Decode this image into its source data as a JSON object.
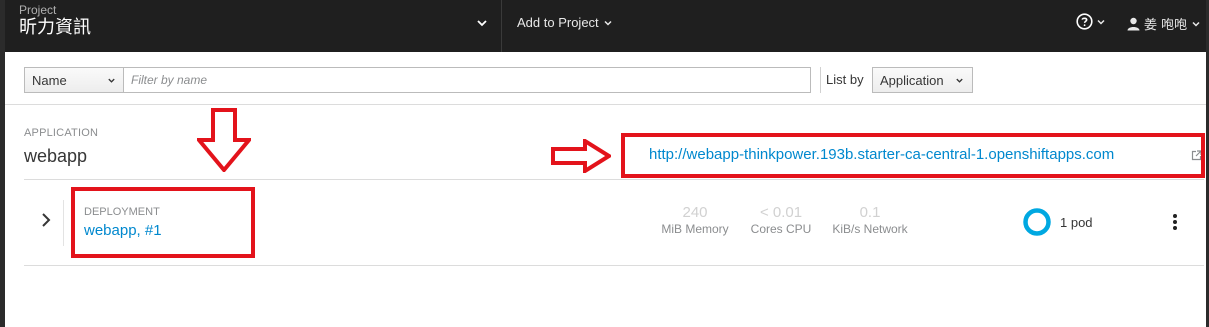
{
  "topbar": {
    "project_caption": "Project",
    "project_name": "昕力資訊",
    "add_to_project": "Add to Project",
    "user_name": "姜 咆咆"
  },
  "filter": {
    "field_select": "Name",
    "input_placeholder": "Filter by name",
    "list_by_label": "List by",
    "list_by_select": "Application"
  },
  "application": {
    "caption": "APPLICATION",
    "name": "webapp",
    "route_url": "http://webapp-thinkpower.193b.starter-ca-central-1.openshiftapps.com"
  },
  "deployment": {
    "caption": "DEPLOYMENT",
    "name": "webapp, #1",
    "metrics": [
      {
        "value": "240",
        "label": "MiB Memory"
      },
      {
        "value": "< 0.01",
        "label": "Cores CPU"
      },
      {
        "value": "0.1",
        "label": "KiB/s Network"
      }
    ],
    "pod_count": 1,
    "pod_label": "1 pod"
  },
  "colors": {
    "topbar_bg": "#1f1f1f",
    "link": "#0088ce",
    "annotation_red": "#e3131b",
    "pod_ring": "#00a8e1"
  },
  "icons": [
    "chevron-down-icon",
    "help-icon",
    "user-icon",
    "external-link-icon",
    "chevron-right-icon",
    "kebab-icon",
    "pod-donut",
    "down-arrow-annotation",
    "right-arrow-annotation"
  ]
}
